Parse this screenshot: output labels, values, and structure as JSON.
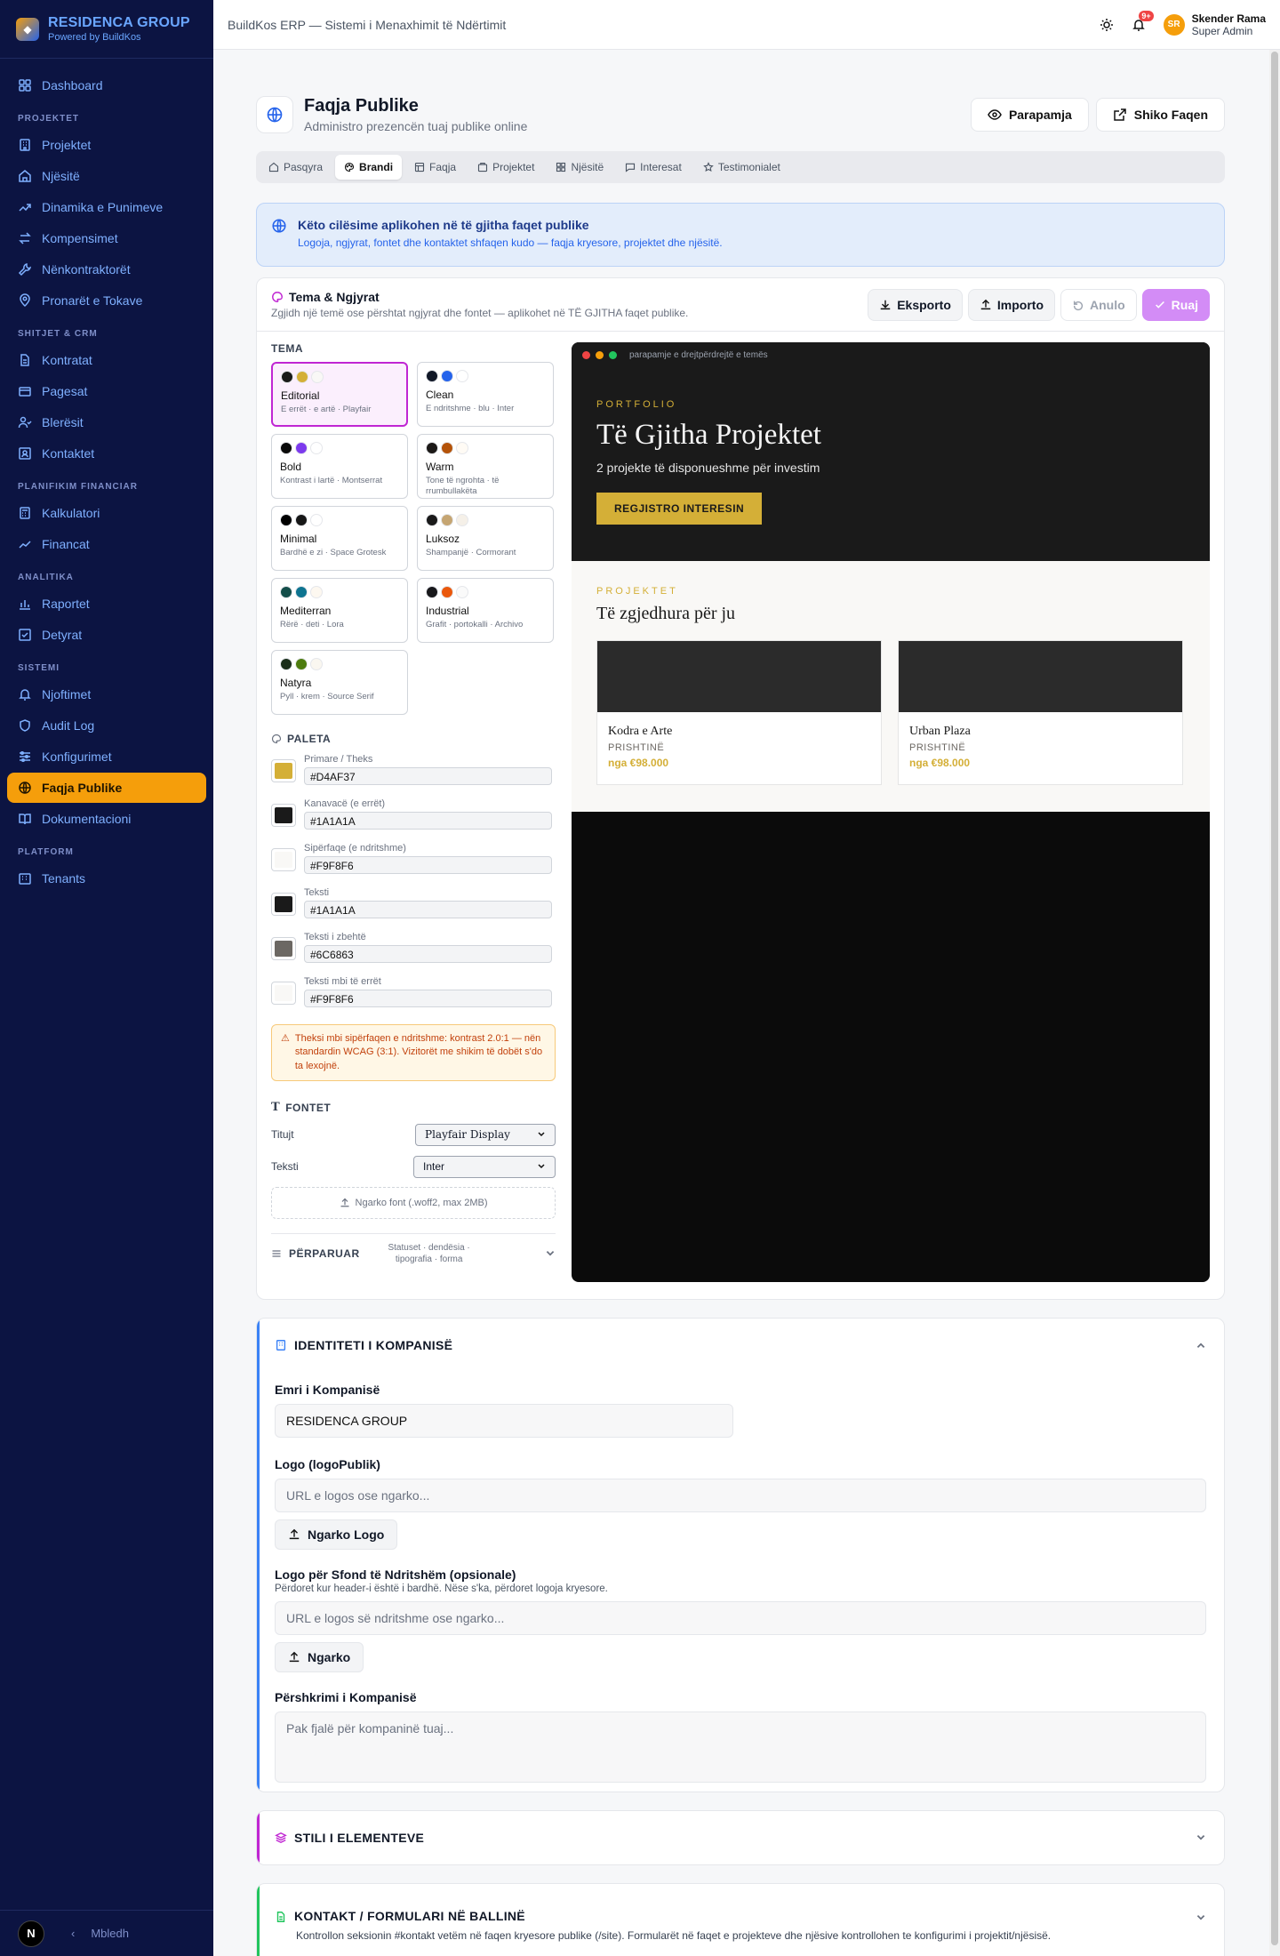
{
  "brand": {
    "title": "RESIDENCA GROUP",
    "subtitle": "Powered by BuildKos"
  },
  "nav": {
    "dashboard": "Dashboard",
    "sections": [
      {
        "title": "PROJEKTET",
        "items": [
          "Projektet",
          "Njësitë",
          "Dinamika e Punimeve",
          "Kompensimet",
          "Nënkontraktorët",
          "Pronarët e Tokave"
        ]
      },
      {
        "title": "SHITJET & CRM",
        "items": [
          "Kontratat",
          "Pagesat",
          "Blerësit",
          "Kontaktet"
        ]
      },
      {
        "title": "PLANIFIKIM FINANCIAR",
        "items": [
          "Kalkulatori",
          "Financat"
        ]
      },
      {
        "title": "ANALITIKA",
        "items": [
          "Raportet",
          "Detyrat"
        ]
      },
      {
        "title": "SISTEMI",
        "items": [
          "Njoftimet",
          "Audit Log",
          "Konfigurimet",
          "Faqja Publike",
          "Dokumentacioni"
        ]
      },
      {
        "title": "PLATFORM",
        "items": [
          "Tenants"
        ]
      }
    ],
    "active": "Faqja Publike",
    "footer_badge": "N",
    "collapse_label": "Mbledh"
  },
  "topbar": {
    "title": "BuildKos ERP — Sistemi i Menaxhimit të Ndërtimit",
    "notif_count": "9+",
    "user_initials": "SR",
    "user_name": "Skender Rama",
    "user_role": "Super Admin"
  },
  "page": {
    "title": "Faqja Publike",
    "subtitle": "Administro prezencën tuaj publike online",
    "preview_btn": "Parapamja",
    "view_btn": "Shiko Faqen"
  },
  "tabs": [
    "Pasqyra",
    "Brandi",
    "Faqja",
    "Projektet",
    "Njësitë",
    "Interesat",
    "Testimonialet"
  ],
  "active_tab": "Brandi",
  "info": {
    "title": "Këto cilësime aplikohen në të gjitha faqet publike",
    "text": "Logoja, ngjyrat, fontet dhe kontaktet shfaqen kudo — faqja kryesore, projektet dhe njësitë."
  },
  "theme_card": {
    "title": "Tema & Ngjyrat",
    "subtitle": "Zgjidh një temë ose përshtat ngjyrat dhe fontet — aplikohet në TË GJITHA faqet publike.",
    "export": "Eksporto",
    "import": "Importo",
    "undo": "Anulo",
    "save": "Ruaj",
    "theme_label": "TEMA",
    "themes": [
      {
        "name": "Editorial",
        "desc": "E errët · e artë · Playfair",
        "colors": [
          "#1A1A1A",
          "#D4AF37",
          "#F9F8F6"
        ],
        "selected": true
      },
      {
        "name": "Clean",
        "desc": "E ndritshme · blu · Inter",
        "colors": [
          "#111827",
          "#2563EB",
          "#FFFFFF"
        ]
      },
      {
        "name": "Bold",
        "desc": "Kontrast i lartë · Montserrat",
        "colors": [
          "#0A0A0A",
          "#7C3AED",
          "#FFFFFF"
        ]
      },
      {
        "name": "Warm",
        "desc": "Tone të ngrohta · të rrumbullakëta",
        "colors": [
          "#1C1917",
          "#B45309",
          "#FFFBF5"
        ]
      },
      {
        "name": "Minimal",
        "desc": "Bardhë e zi · Space Grotesk",
        "colors": [
          "#000000",
          "#171717",
          "#FFFFFF"
        ]
      },
      {
        "name": "Luksoz",
        "desc": "Shampanjë · Cormorant",
        "colors": [
          "#1A1A1A",
          "#C5A572",
          "#F5F0E8"
        ]
      },
      {
        "name": "Mediterran",
        "desc": "Rërë · deti · Lora",
        "colors": [
          "#134E4A",
          "#0E7490",
          "#FDF8F0"
        ]
      },
      {
        "name": "Industrial",
        "desc": "Grafit · portokalli · Archivo",
        "colors": [
          "#18181B",
          "#EA580C",
          "#FAFAFA"
        ]
      },
      {
        "name": "Natyra",
        "desc": "Pyll · krem · Source Serif",
        "colors": [
          "#1A2E1A",
          "#4D7C0F",
          "#FAF7F0"
        ]
      }
    ],
    "palette_label": "PALETA",
    "palette": [
      {
        "label": "Primare / Theks",
        "value": "#D4AF37"
      },
      {
        "label": "Kanavacë (e errët)",
        "value": "#1A1A1A"
      },
      {
        "label": "Sipërfaqe (e ndritshme)",
        "value": "#F9F8F6"
      },
      {
        "label": "Teksti",
        "value": "#1A1A1A"
      },
      {
        "label": "Teksti i zbehtë",
        "value": "#6C6863"
      },
      {
        "label": "Teksti mbi të errët",
        "value": "#F9F8F6"
      }
    ],
    "warning": "Theksi mbi sipërfaqen e ndritshme: kontrast 2.0:1 — nën standardin WCAG (3:1). Vizitorët me shikim të dobët s'do ta lexojnë.",
    "fonts_label": "FONTET",
    "heading_label": "Titujt",
    "heading_font": "Playfair Display",
    "body_label": "Teksti",
    "body_font": "Inter",
    "upload_font": "Ngarko font (.woff2, max 2MB)",
    "advanced_label": "PËRPARUAR",
    "advanced_desc": "Statuset · dendësia · tipografia · forma"
  },
  "preview": {
    "url": "parapamje e drejtpërdrejtë e temës",
    "kicker": "PORTFOLIO",
    "title": "Të Gjitha Projektet",
    "subtitle": "2 projekte të disponueshme për investim",
    "cta": "REGJISTRO INTERESIN",
    "section_kicker": "PROJEKTET",
    "section_title": "Të zgjedhura për ju",
    "cards": [
      {
        "name": "Kodra e Arte",
        "city": "PRISHTINË",
        "price": "nga €98.000"
      },
      {
        "name": "Urban Plaza",
        "city": "PRISHTINË",
        "price": "nga €98.000"
      }
    ]
  },
  "identity": {
    "title": "IDENTITETI I KOMPANISË",
    "name_label": "Emri i Kompanisë",
    "name_value": "RESIDENCA GROUP",
    "logo_label": "Logo (logoPublik)",
    "logo_placeholder": "URL e logos ose ngarko...",
    "logo_btn": "Ngarko Logo",
    "light_logo_label": "Logo për Sfond të Ndritshëm (opsionale)",
    "light_logo_help": "Përdoret kur header-i është i bardhë. Nëse s'ka, përdoret logoja kryesore.",
    "light_logo_placeholder": "URL e logos së ndritshme ose ngarko...",
    "light_logo_btn": "Ngarko",
    "desc_label": "Përshkrimi i Kompanisë",
    "desc_placeholder": "Pak fjalë për kompaninë tuaj..."
  },
  "styles_section": {
    "title": "STILI I ELEMENTEVE"
  },
  "contact_section": {
    "title": "KONTAKT / FORMULARI NË BALLINË",
    "text": "Kontrollon seksionin #kontakt vetëm në faqen kryesore publike (/site). Formularët në faqet e projekteve dhe njësive kontrollohen te konfigurimi i projektit/njësisë."
  },
  "colors": {
    "sidebar": "#0C1442",
    "accent": "#F59E0B",
    "identity_accent": "#3B82F6",
    "styles_accent": "#C026D3",
    "contact_accent": "#22C55E"
  }
}
